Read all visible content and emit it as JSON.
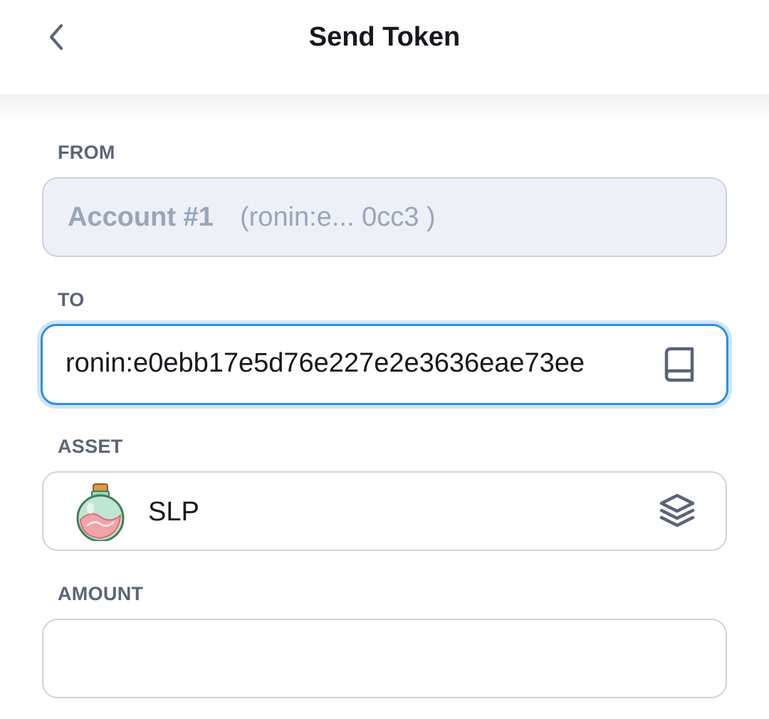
{
  "header": {
    "title": "Send Token",
    "back_icon": "chevron-left-icon"
  },
  "from": {
    "label": "FROM",
    "account_name": "Account #1",
    "account_address": "(ronin:e...  0cc3 )"
  },
  "to": {
    "label": "TO",
    "value": "ronin:e0ebb17e5d76e227e2e3636eae73ee",
    "address_book_icon": "book-icon"
  },
  "asset": {
    "label": "ASSET",
    "symbol": "SLP",
    "token_icon": "slp-potion-icon",
    "select_icon": "layers-icon"
  },
  "amount": {
    "label": "AMOUNT",
    "value": ""
  },
  "colors": {
    "accent": "#2d8fe0",
    "label": "#5b6478",
    "disabled_text": "#9aa5ba",
    "disabled_bg": "#edf0f7"
  }
}
